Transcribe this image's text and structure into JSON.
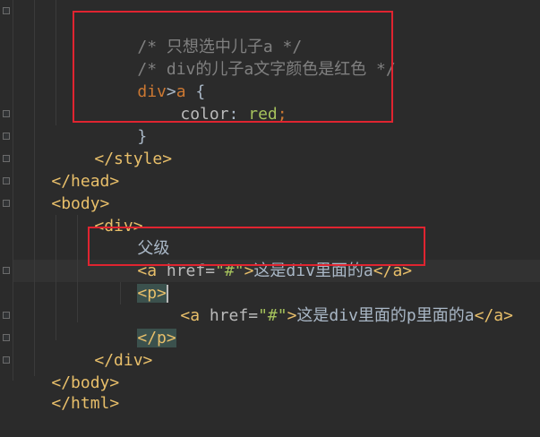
{
  "code": {
    "l1_comment": "/* 只想选中儿子a */",
    "l2_comment": "/* div的儿子a文字颜色是红色 */",
    "l3_sel_tag": "div",
    "l3_combinator": ">",
    "l3_sel_child": "a",
    "l3_brace": " {",
    "l4_prop": "color",
    "l4_colon": ": ",
    "l4_value": "red",
    "l4_semi": ";",
    "l5_brace": "}",
    "l6": "</style>",
    "l7": "</head>",
    "l8": "<body>",
    "l9": "<div>",
    "l10_text": "父级",
    "l11_open": "<a ",
    "l11_attr": "href=",
    "l11_val": "\"#\"",
    "l11_gt": ">",
    "l11_text": "这是div里面的a",
    "l11_close": "</a>",
    "l12": "<p>",
    "l13_open": "<a ",
    "l13_attr": "href=",
    "l13_val": "\"#\"",
    "l13_gt": ">",
    "l13_text": "这是div里面的p里面的a",
    "l13_close": "</a>",
    "l14": "</p>",
    "l15": "</div>",
    "l16": "</body>",
    "l17": "</html>"
  },
  "colors": {
    "background": "#2b2b2b",
    "tag": "#e8bf6a",
    "comment": "#808080",
    "string": "#a5c25c",
    "selector": "#cc7832",
    "annotation_box": "#e02430"
  }
}
